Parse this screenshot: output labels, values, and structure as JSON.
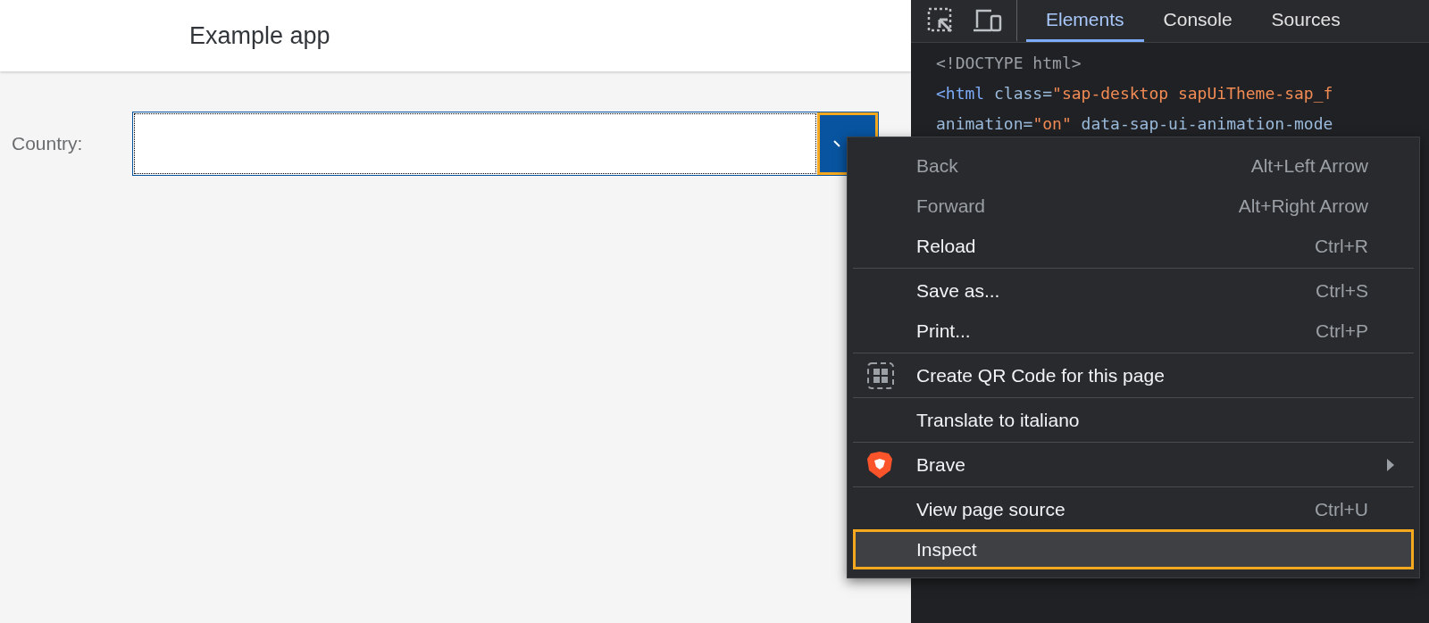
{
  "app": {
    "title": "Example app",
    "field": {
      "label": "Country:",
      "focused": true
    }
  },
  "devtools": {
    "tabs": [
      {
        "label": "Elements",
        "selected": true
      },
      {
        "label": "Console",
        "selected": false
      },
      {
        "label": "Sources",
        "selected": false
      }
    ],
    "code_lines": [
      [
        {
          "kind": "doctype",
          "text": "<!DOCTYPE html>"
        }
      ],
      [
        {
          "kind": "tag",
          "text": "<html"
        },
        {
          "kind": "attr",
          "text": " class="
        },
        {
          "kind": "value",
          "text": "\"sap-desktop sapUiTheme-sap_f"
        }
      ],
      [
        {
          "kind": "attr",
          "text": "animation="
        },
        {
          "kind": "value",
          "text": "\"on\""
        },
        {
          "kind": "attr",
          "text": " data-sap-ui-animation-mode"
        }
      ]
    ]
  },
  "context_menu": {
    "groups": [
      [
        {
          "label": "Back",
          "shortcut": "Alt+Left Arrow",
          "disabled": true,
          "selected": false
        },
        {
          "label": "Forward",
          "shortcut": "Alt+Right Arrow",
          "disabled": true,
          "selected": false
        },
        {
          "label": "Reload",
          "shortcut": "Ctrl+R",
          "disabled": false,
          "selected": false
        }
      ],
      [
        {
          "label": "Save as...",
          "shortcut": "Ctrl+S",
          "disabled": false,
          "selected": false
        },
        {
          "label": "Print...",
          "shortcut": "Ctrl+P",
          "disabled": false,
          "selected": false
        }
      ],
      [
        {
          "label": "Create QR Code for this page",
          "kind": "qr",
          "disabled": false,
          "selected": false
        }
      ],
      [
        {
          "label": "Translate to italiano",
          "disabled": false,
          "selected": false
        }
      ],
      [
        {
          "label": "Brave",
          "kind": "brave",
          "submenu": true,
          "disabled": false,
          "selected": false
        }
      ],
      [
        {
          "label": "View page source",
          "shortcut": "Ctrl+U",
          "disabled": false,
          "selected": false
        },
        {
          "label": "Inspect",
          "disabled": false,
          "selected": true
        }
      ]
    ]
  }
}
